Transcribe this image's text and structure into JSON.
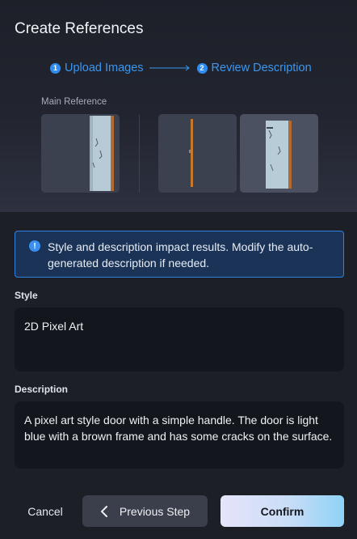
{
  "dialog": {
    "title": "Create References"
  },
  "steps": [
    {
      "number": "1",
      "label": "Upload Images"
    },
    {
      "number": "2",
      "label": "Review Description"
    }
  ],
  "references": {
    "main_label": "Main Reference",
    "images": [
      {
        "name": "door-main",
        "description_icon": "image"
      },
      {
        "name": "door-side",
        "description_icon": "image"
      },
      {
        "name": "door-alt",
        "description_icon": "image"
      }
    ]
  },
  "banner": {
    "icon": "info-icon",
    "text": "Style and description impact results. Modify the auto-generated description if needed."
  },
  "style_field": {
    "label": "Style",
    "value": "2D Pixel Art"
  },
  "description_field": {
    "label": "Description",
    "value": "A pixel art style door with a simple handle. The door is light blue with a brown frame and has some cracks on the surface."
  },
  "footer": {
    "cancel_label": "Cancel",
    "previous_label": "Previous Step",
    "confirm_label": "Confirm"
  },
  "colors": {
    "accent": "#2f8cf0",
    "banner_border": "#2f82e0",
    "background": "#1c1f26"
  }
}
